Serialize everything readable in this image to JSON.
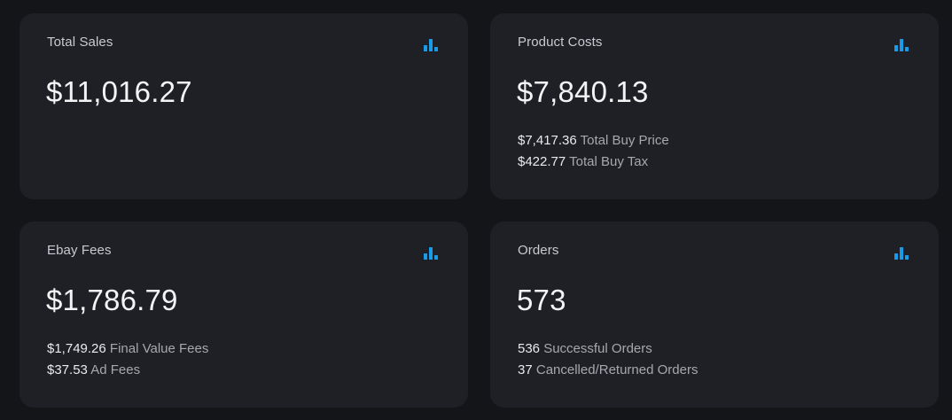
{
  "cards": [
    {
      "title": "Total Sales",
      "icon": "bar-chart-icon",
      "value": "$11,016.27",
      "details": []
    },
    {
      "title": "Product Costs",
      "icon": "bar-chart-icon",
      "value": "$7,840.13",
      "details": [
        {
          "amount": "$7,417.36",
          "label": "Total Buy Price"
        },
        {
          "amount": "$422.77",
          "label": "Total Buy Tax"
        }
      ]
    },
    {
      "title": "Ebay Fees",
      "icon": "bar-chart-icon",
      "value": "$1,786.79",
      "details": [
        {
          "amount": "$1,749.26",
          "label": "Final Value Fees"
        },
        {
          "amount": "$37.53",
          "label": "Ad Fees"
        }
      ]
    },
    {
      "title": "Orders",
      "icon": "bar-chart-icon",
      "value": "573",
      "details": [
        {
          "amount": "536",
          "label": "Successful Orders"
        },
        {
          "amount": "37",
          "label": "Cancelled/Returned Orders"
        }
      ]
    }
  ],
  "colors": {
    "background": "#141518",
    "card": "#1f2026",
    "accent": "#1a9be8"
  }
}
